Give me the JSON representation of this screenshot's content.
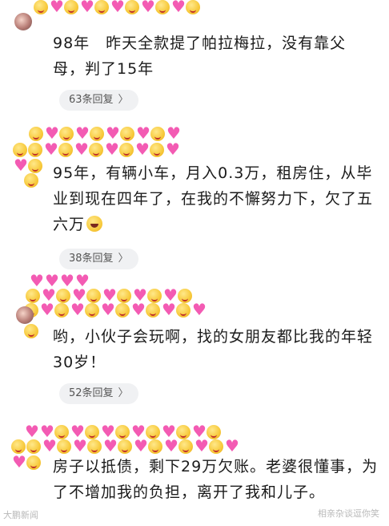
{
  "comments": [
    {
      "text": "98年　昨天全款提了帕拉梅拉，没有靠父母，判了15年",
      "reply_label": "63条回复"
    },
    {
      "text": "95年，有辆小车，月入0.3万，租房住，从毕业到现在四年了，在我的不懈努力下，欠了五六万",
      "reply_label": "38条回复",
      "trailing_emoji": "laughing-tears-emoji"
    },
    {
      "text": "哟，小伙子会玩啊，找的女朋友都比我的年轻30岁！",
      "reply_label": "52条回复"
    },
    {
      "text": "房子以抵债，剩下29万欠账。老婆很懂事，为了不增加我的负担，离开了我和儿子。"
    }
  ],
  "icons": {
    "reply_chevron": "chevron-right-icon",
    "name_emoji_a": "smiling-face-emoji",
    "name_emoji_b": "pink-heart-emoji"
  },
  "colors": {
    "pill_background": "#f0f1f3",
    "heart": "#f35bb3",
    "emoji_face": "#f7c93a"
  },
  "watermarks": {
    "left": "大鹏新闻",
    "right": "相亲杂谈逗你笑"
  }
}
